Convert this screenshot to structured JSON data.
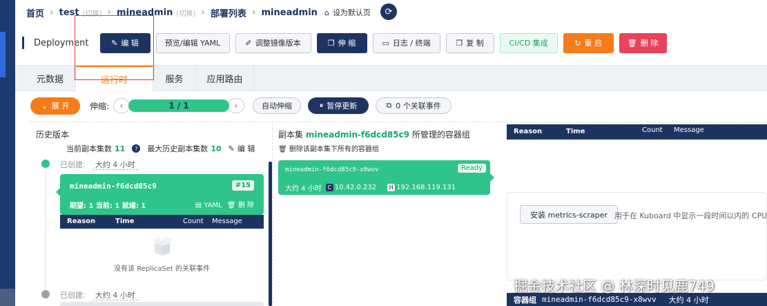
{
  "colors": {
    "navy": "#1d3461",
    "green": "#2ec48a",
    "orange": "#f57c18",
    "red": "#e8435a"
  },
  "breadcrumb": {
    "home": "首页",
    "namespace": "test",
    "namespace_switch": "[切换]",
    "app": "mineadmin",
    "app_switch": "[切换]",
    "list": "部署列表",
    "current": "mineadmin",
    "set_default": "设为默认页"
  },
  "toolbar": {
    "kind": "Deployment",
    "edit": "编 辑",
    "preview_yaml": "预览/编辑 YAML",
    "adjust_image": "调整镜像版本",
    "scale": "伸 缩",
    "logs": "日志 / 终端",
    "copy": "复 制",
    "cicd": "CI/CD 集成",
    "restart": "重 启",
    "delete": "删 除"
  },
  "tabs": [
    "元数据",
    "运行时",
    "服务",
    "应用路由"
  ],
  "controls": {
    "expand": "展 开",
    "scale_label": "伸缩:",
    "scale_value": "1 / 1",
    "auto_scale": "自动伸缩",
    "pause_update": "暂停更新",
    "events": "0 个关联事件"
  },
  "history": {
    "title": "历史版本",
    "current_replicas_label": "当前副本集数",
    "current_replicas": "11",
    "max_history_label": "最大历史副本集数",
    "max_history": "10",
    "edit": "编 辑",
    "created_label": "已创建:",
    "created_ago": "大约 4 小时",
    "replicaset": {
      "name": "mineadmin-f6dcd85c9",
      "revision": "#15",
      "status": "期望: 1 当前: 1 就绪: 1",
      "yaml": "YAML",
      "delete": "删 除"
    },
    "events_header": {
      "reason": "Reason",
      "time": "Time",
      "count": "Count",
      "message": "Message"
    },
    "no_events": "没有该 ReplicaSet 的关联事件",
    "created_label_2": "已创建:",
    "created_ago_2": "大约 4 小时"
  },
  "pods": {
    "title_prefix": "副本集",
    "replicaset": "mineadmin-f6dcd85c9",
    "title_suffix": "所管理的容器组",
    "delete_all": "删除该副本集下所有的容器组",
    "pod": {
      "name": "mineadmin-f6dcd85c9-x8wvv",
      "status": "Ready",
      "age": "大约 4 小时",
      "container_ip_tag": "C",
      "container_ip": "10.42.0.232",
      "host_ip_tag": "H",
      "host_ip": "192.168.119.131"
    }
  },
  "right": {
    "events_header": {
      "reason": "Reason",
      "time": "Time",
      "count": "Count",
      "message": "Message"
    },
    "metrics_button": "安装 metrics-scraper",
    "metrics_desc": "用于在 Kuboard 中显示一段时间以内的 CPU/内",
    "footer_label": "容器组",
    "footer_pod": "mineadmin-f6dcd85c9-x8wvv",
    "footer_age": "大约 4 小时"
  },
  "watermark": "掘金技术社区 @ 林深时见鹿749"
}
